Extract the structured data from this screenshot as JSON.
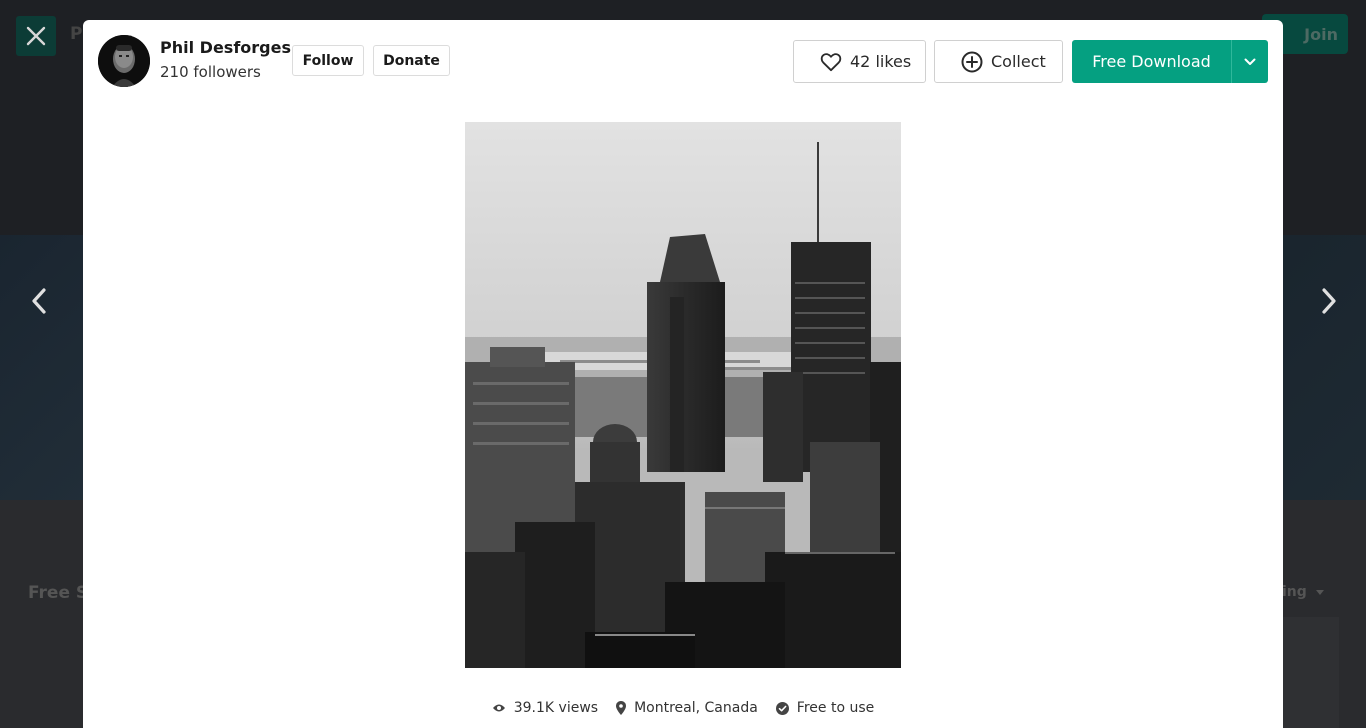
{
  "background": {
    "join_label": "Join",
    "logo_partial": "P",
    "section_title": "Free S",
    "sort_partial": "ing"
  },
  "author": {
    "name": "Phil Desforges",
    "followers": "210 followers",
    "follow_label": "Follow",
    "donate_label": "Donate"
  },
  "actions": {
    "likes_label": "42 likes",
    "collect_label": "Collect",
    "download_label": "Free Download"
  },
  "meta": {
    "views": "39.1K views",
    "location": "Montreal, Canada",
    "license": "Free to use"
  },
  "colors": {
    "accent": "#05a081",
    "overlay": "#2b2c30"
  },
  "icons": {
    "close": "close-icon",
    "prev": "chevron-left-icon",
    "next": "chevron-right-icon",
    "likes": "heart-icon",
    "collect": "plus-circle-icon",
    "download_menu": "chevron-down-icon",
    "views": "eye-icon",
    "location": "location-pin-icon",
    "license": "check-circle-icon"
  }
}
